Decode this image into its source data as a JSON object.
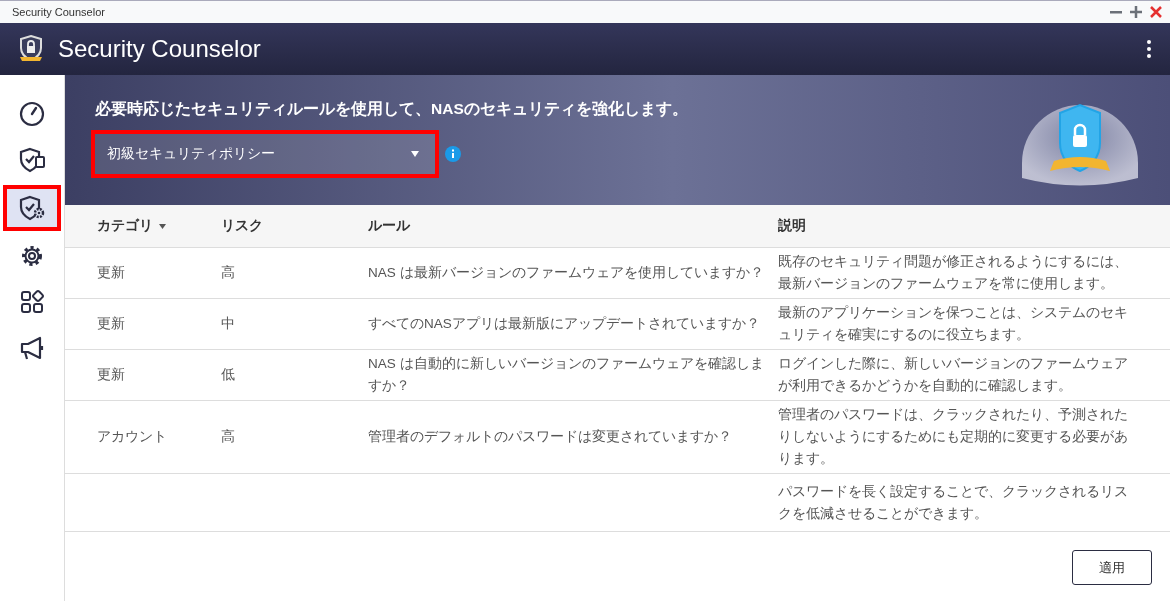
{
  "window": {
    "title": "Security Counselor"
  },
  "header": {
    "title": "Security Counselor"
  },
  "sidebar": {
    "items": [
      {
        "kind": "gauge",
        "selected": false,
        "highlighted": false
      },
      {
        "kind": "shield-card",
        "selected": false,
        "highlighted": false
      },
      {
        "kind": "shield-gear",
        "selected": true,
        "highlighted": true
      },
      {
        "kind": "gear",
        "selected": false,
        "highlighted": false
      },
      {
        "kind": "apps",
        "selected": false,
        "highlighted": false
      },
      {
        "kind": "megaphone",
        "selected": false,
        "highlighted": false
      }
    ]
  },
  "banner": {
    "heading": "必要時応じたセキュリティルールを使用して、NASのセキュリティを強化します。",
    "policy_dropdown": {
      "value": "初級セキュリティポリシー",
      "highlighted": true
    }
  },
  "table": {
    "columns": [
      {
        "label": "カテゴリ",
        "sortable": true
      },
      {
        "label": "リスク",
        "sortable": false
      },
      {
        "label": "ルール",
        "sortable": false
      },
      {
        "label": "説明",
        "sortable": false
      }
    ],
    "rows": [
      {
        "category": "更新",
        "risk": "高",
        "rule": "NAS は最新バージョンのファームウェアを使用していますか？",
        "description": "既存のセキュリティ問題が修正されるようにするには、最新バージョンのファームウェアを常に使用します。"
      },
      {
        "category": "更新",
        "risk": "中",
        "rule": "すべてのNASアプリは最新版にアップデートされていますか？",
        "description": "最新のアプリケーションを保つことは、システムのセキュリティを確実にするのに役立ちます。"
      },
      {
        "category": "更新",
        "risk": "低",
        "rule": "NAS は自動的に新しいバージョンのファームウェアを確認しますか？",
        "description": "ログインした際に、新しいバージョンのファームウェアが利用できるかどうかを自動的に確認します。"
      },
      {
        "category": "アカウント",
        "risk": "高",
        "rule": "管理者のデフォルトのパスワードは変更されていますか？",
        "description": "管理者のパスワードは、クラックされたり、予測されたりしないようにするためにも定期的に変更する必要があります。"
      },
      {
        "description": "パスワードを長く設定することで、クラックされるリスクを低減させることができます。"
      }
    ]
  },
  "apply_button": "適用"
}
